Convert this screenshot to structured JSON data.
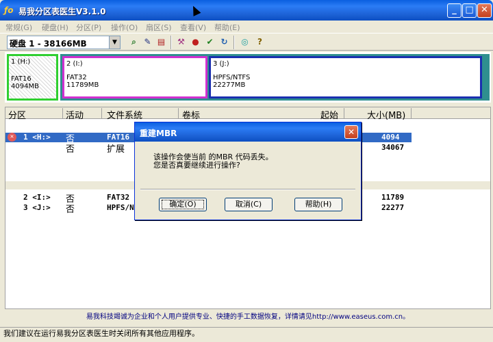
{
  "window": {
    "title": "易我分区表医生V3.1.0"
  },
  "menu": [
    "常规(G)",
    "硬盘(H)",
    "分区(P)",
    "操作(O)",
    "扇区(S)",
    "查看(V)",
    "帮助(E)"
  ],
  "toolbar": {
    "disk_selector": "硬盘 1 - 38166MB"
  },
  "icons": [
    "search-icon",
    "edit-icon",
    "rebuild-icon",
    "tools-icon",
    "find-icon",
    "check-icon",
    "refresh-icon",
    "globe-icon",
    "help-icon"
  ],
  "partition_map": [
    {
      "label": "1 (H:)",
      "fs": "FAT16",
      "size": "4094MB",
      "color": "#2fcf2f"
    },
    {
      "label": "2 (I:)",
      "fs": "FAT32",
      "size": "11789MB",
      "color": "#d030d0"
    },
    {
      "label": "3 (J:)",
      "fs": "HPFS/NTFS",
      "size": "22277MB",
      "color": "#1a2fb0"
    }
  ],
  "table": {
    "headers": [
      "分区",
      "活动",
      "文件系统",
      "卷标",
      "起始",
      "大小(MB)"
    ],
    "rows": [
      {
        "part": "1 <H:>",
        "active": "否",
        "fs": "FAT16",
        "size": "4094",
        "selected": true
      },
      {
        "part": "",
        "active": "否",
        "fs": "扩展",
        "size": "34067",
        "selected": false
      },
      {
        "part": "2 <I:>",
        "active": "否",
        "fs": "FAT32",
        "size": "11789",
        "selected": false
      },
      {
        "part": "3 <J:>",
        "active": "否",
        "fs": "HPFS/N",
        "size": "22277",
        "selected": false
      }
    ]
  },
  "notice": "易我科技竭诚为企业和个人用户提供专业、快捷的手工数据恢复，详情请见http://www.easeus.com.cn。",
  "status": "我们建议在运行易我分区表医生时关闭所有其他应用程序。",
  "dialog": {
    "title": "重建MBR",
    "line1": "该操作会使当前 的MBR 代码丢失。",
    "line2": "您是否真要继续进行操作?",
    "ok": "确定(O)",
    "cancel": "取消(C)",
    "help": "帮助(H)"
  }
}
